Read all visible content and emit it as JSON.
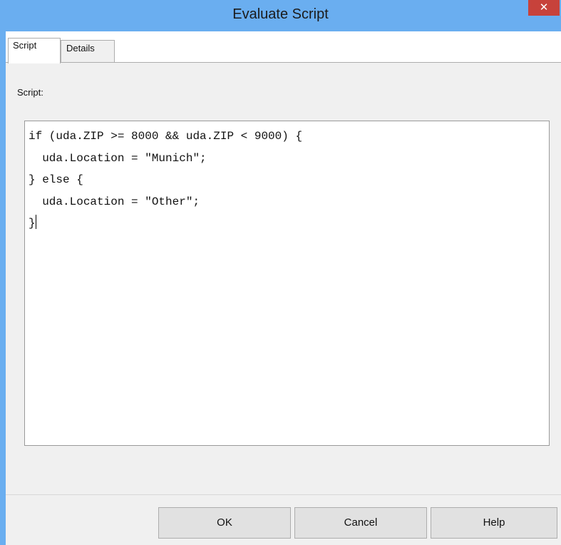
{
  "window": {
    "title": "Evaluate Script",
    "close_glyph": "✕"
  },
  "tabs": [
    {
      "label": "Script",
      "active": true
    },
    {
      "label": "Details",
      "active": false
    }
  ],
  "script": {
    "label": "Script:",
    "lines": [
      "if (uda.ZIP >= 8000 && uda.ZIP < 9000) {",
      "  uda.Location = \"Munich\";",
      "} else {",
      "  uda.Location = \"Other\";",
      "}"
    ]
  },
  "buttons": {
    "ok": "OK",
    "cancel": "Cancel",
    "help": "Help"
  },
  "colors": {
    "titlebar": "#6aaef0",
    "close_button": "#c7423b",
    "dialog_background": "#f0f0f0"
  },
  "icons": {
    "close": "close-icon"
  }
}
